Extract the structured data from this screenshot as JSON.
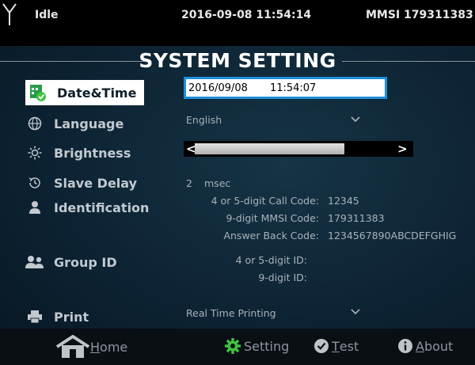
{
  "status": {
    "state": "Idle",
    "datetime": "2016-09-08 11:54:14",
    "mmsi": "MMSI 179311383"
  },
  "title": "SYSTEM SETTING",
  "menu": [
    {
      "id": "datetime",
      "label": "Date&Time",
      "icon": "calendar-check-icon",
      "active": true
    },
    {
      "id": "language",
      "label": "Language",
      "icon": "globe-icon"
    },
    {
      "id": "brightness",
      "label": "Brightness",
      "icon": "sun-icon"
    },
    {
      "id": "slave_delay",
      "label": "Slave Delay",
      "icon": "history-icon"
    },
    {
      "id": "identification",
      "label": "Identification",
      "icon": "user-icon"
    },
    {
      "id": "group_id",
      "label": "Group ID",
      "icon": "users-icon"
    },
    {
      "id": "print",
      "label": "Print",
      "icon": "printer-icon"
    }
  ],
  "datetime_field": {
    "date": "2016/09/08",
    "time": "11:54:07"
  },
  "language_value": "English",
  "brightness": {
    "left": "<",
    "right": ">",
    "level": 0.72
  },
  "slave_delay": {
    "value": "2",
    "unit": "msec"
  },
  "identification": {
    "call_code_label": "4 or 5-digit Call Code:",
    "call_code_value": "12345",
    "mmsi_label": "9-digit MMSI Code:",
    "mmsi_value": "179311383",
    "answer_back_label": "Answer Back Code:",
    "answer_back_value": "1234567890ABCDEFGHIG"
  },
  "group_id": {
    "short_label": "4 or 5-digit ID:",
    "long_label": "9-digit ID:"
  },
  "print_value": "Real Time Printing",
  "nav": {
    "home_first": "H",
    "home_rest": "ome",
    "setting": "Setting",
    "test_first": "T",
    "test_rest": "est",
    "about_first": "A",
    "about_rest": "bout"
  },
  "colors": {
    "accent": "#1e8fd8",
    "setting_icon": "#3ec43e",
    "background": "#0d2333"
  }
}
